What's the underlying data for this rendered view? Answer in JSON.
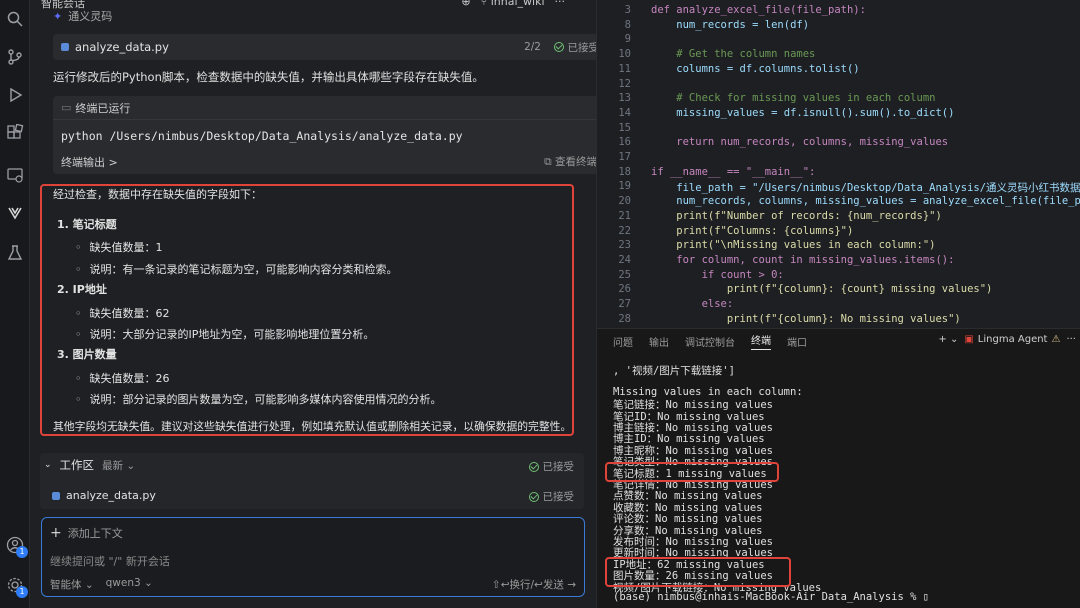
{
  "chat": {
    "panel_title": "智能会话",
    "workspace_name": "inhai_wiki",
    "agent_name": "通义灵码",
    "file_card": {
      "name": "analyze_data.py",
      "count": "2/2",
      "status": "已接受"
    },
    "para1": "运行修改后的Python脚本，检查数据中的缺失值，并输出具体哪些字段存在缺失值。",
    "terminal_card": {
      "header": "终端已运行",
      "command": "python /Users/nimbus/Desktop/Data_Analysis/analyze_data.py",
      "output_label": "终端输出 >",
      "view_label": "查看终端"
    },
    "answer": {
      "intro": "经过检查，数据中存在缺失值的字段如下：",
      "items": [
        {
          "title": "1. 笔记标题",
          "count": "缺失值数量：1",
          "note": "说明：有一条记录的笔记标题为空，可能影响内容分类和检索。"
        },
        {
          "title": "2. IP地址",
          "count": "缺失值数量：62",
          "note": "说明：大部分记录的IP地址为空，可能影响地理位置分析。"
        },
        {
          "title": "3. 图片数量",
          "count": "缺失值数量：26",
          "note": "说明：部分记录的图片数量为空，可能影响多媒体内容使用情况的分析。"
        }
      ],
      "conclusion": "其他字段均无缺失值。建议对这些缺失值进行处理，例如填充默认值或删除相关记录，以确保数据的完整性。"
    },
    "workspace": {
      "label": "工作区",
      "latest": "最新",
      "status": "已接受",
      "file": "analyze_data.py",
      "file_status": "已接受"
    },
    "input": {
      "add_context": "添加上下文",
      "placeholder": "继续提问或 \"/\" 新开会话",
      "mode": "智能体",
      "model": "qwen3",
      "send_hint": "⇧↩换行/↩发送"
    }
  },
  "editor": {
    "lines": [
      {
        "n": "3",
        "t": "def analyze_excel_file(file_path):"
      },
      {
        "n": "8",
        "t": "    num_records = len(df)"
      },
      {
        "n": "9",
        "t": ""
      },
      {
        "n": "10",
        "t": "    # Get the column names"
      },
      {
        "n": "11",
        "t": "    columns = df.columns.tolist()"
      },
      {
        "n": "12",
        "t": ""
      },
      {
        "n": "13",
        "t": "    # Check for missing values in each column"
      },
      {
        "n": "14",
        "t": "    missing_values = df.isnull().sum().to_dict()"
      },
      {
        "n": "15",
        "t": ""
      },
      {
        "n": "16",
        "t": "    return num_records, columns, missing_values"
      },
      {
        "n": "17",
        "t": ""
      },
      {
        "n": "18",
        "t": "if __name__ == \"__main__\":"
      },
      {
        "n": "19",
        "t": "    file_path = \"/Users/nimbus/Desktop/Data_Analysis/通义灵码小红书数据.xlsx"
      },
      {
        "n": "20",
        "t": "    num_records, columns, missing_values = analyze_excel_file(file_path)"
      },
      {
        "n": "21",
        "t": "    print(f\"Number of records: {num_records}\")"
      },
      {
        "n": "22",
        "t": "    print(f\"Columns: {columns}\")"
      },
      {
        "n": "23",
        "t": "    print(\"\\nMissing values in each column:\")"
      },
      {
        "n": "24",
        "t": "    for column, count in missing_values.items():"
      },
      {
        "n": "25",
        "t": "        if count > 0:"
      },
      {
        "n": "26",
        "t": "            print(f\"{column}: {count} missing values\")"
      },
      {
        "n": "27",
        "t": "        else:"
      },
      {
        "n": "28",
        "t": "            print(f\"{column}: No missing values\")"
      }
    ]
  },
  "panel": {
    "tabs": [
      "问题",
      "输出",
      "调试控制台",
      "终端",
      "端口"
    ],
    "active_tab": "终端",
    "agent_label": "Lingma Agent",
    "lines": [
      ", '视频/图片下载链接']",
      "",
      "Missing values in each column:",
      "笔记链接：No missing values",
      "笔记ID：No missing values",
      "博主链接：No missing values",
      "博主ID：No missing values",
      "博主昵称：No missing values",
      "笔记类型：No missing values",
      "笔记标题：1 missing values",
      "笔记详情：No missing values",
      "点赞数：No missing values",
      "收藏数：No missing values",
      "评论数：No missing values",
      "分享数：No missing values",
      "发布时间：No missing values",
      "更新时间：No missing values",
      "IP地址：62 missing values",
      "图片数量：26 missing values",
      "视频/图片下载链接：No missing values",
      "(base) nimbus@inhais-MacBook-Air Data_Analysis % ▯"
    ]
  }
}
